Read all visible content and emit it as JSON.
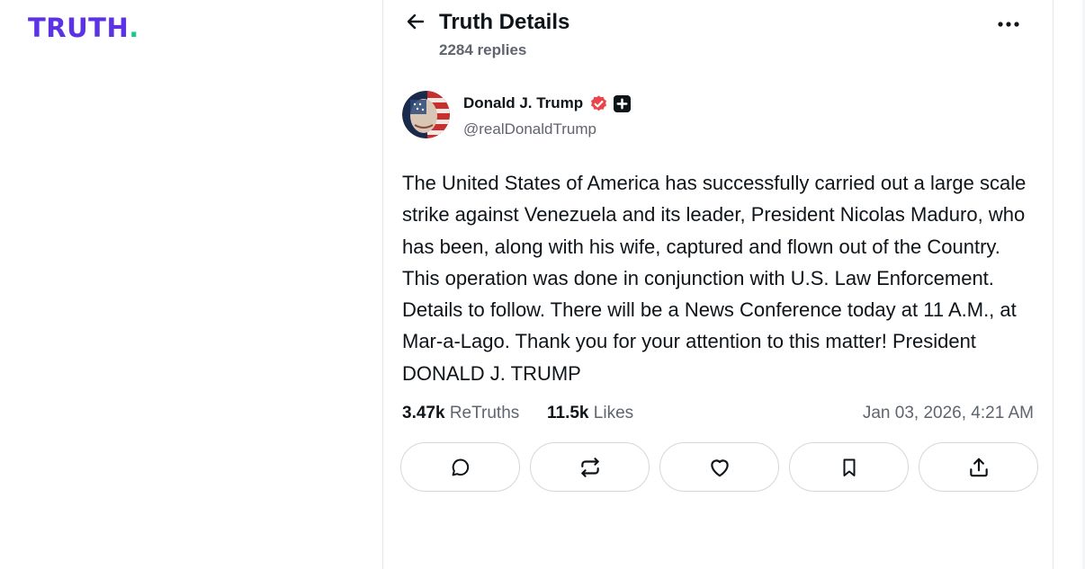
{
  "brand": {
    "logo_text": "TRUTH",
    "logo_dot": ".",
    "primary_color": "#5b32e6",
    "dot_color": "#17c98c"
  },
  "header": {
    "title": "Truth Details",
    "replies": "2284 replies"
  },
  "post": {
    "author_name": "Donald J. Trump",
    "author_handle": "@realDonaldTrump",
    "verified_color": "#e8464c",
    "body": "The United States of America has successfully carried out a large scale strike against Venezuela and its leader, President Nicolas Maduro, who has been, along with his wife, captured and flown out of the Country. This operation was done in conjunction with U.S. Law Enforcement. Details to follow. There will be a News Conference today at 11 A.M., at Mar-a-Lago. Thank you for your attention to this matter! President DONALD J. TRUMP",
    "retruths_count": "3.47k",
    "retruths_label": "ReTruths",
    "likes_count": "11.5k",
    "likes_label": "Likes",
    "timestamp": "Jan 03, 2026, 4:21 AM"
  },
  "icons": {
    "back": "arrow-left-icon",
    "more": "more-horizontal-icon",
    "reply": "chat-bubble-icon",
    "retruth": "repost-icon",
    "like": "heart-icon",
    "bookmark": "bookmark-icon",
    "share": "share-icon"
  }
}
